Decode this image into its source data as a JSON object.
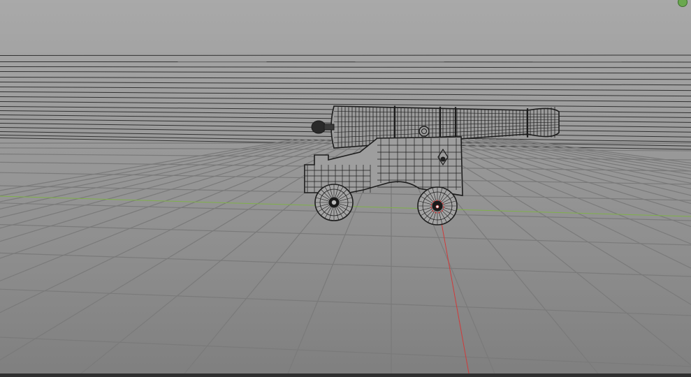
{
  "app": {
    "type": "3d-viewport",
    "shading_mode": "wireframe",
    "object": "cannon"
  },
  "colors": {
    "background_top": "#a9a9a9",
    "background_bottom": "#7f7f7f",
    "grid_line": "#7a7a7a",
    "wire": "#1c1c1c",
    "x_axis": "#d03a3a",
    "y_axis": "#7fb04a",
    "status_dot": "#6aa84f"
  },
  "icons": {
    "origin": "origin-icon",
    "status": "status-dot-icon"
  }
}
